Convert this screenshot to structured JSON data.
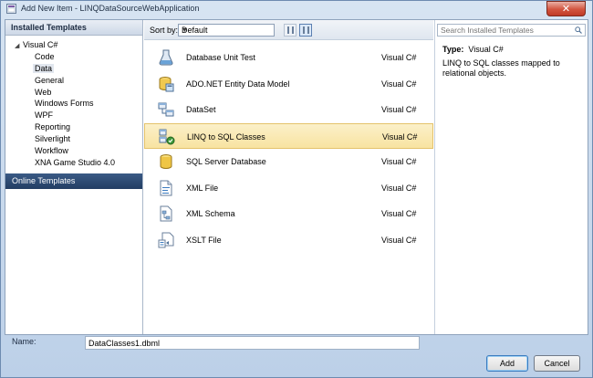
{
  "window": {
    "title": "Add New Item - LINQDataSourceWebApplication",
    "close_glyph": "✕"
  },
  "left": {
    "header": "Installed Templates",
    "root": "Visual C#",
    "children": [
      "Code",
      "Data",
      "General",
      "Web",
      "Windows Forms",
      "WPF",
      "Reporting",
      "Silverlight",
      "Workflow",
      "XNA Game Studio 4.0"
    ],
    "selected": "Data",
    "online": "Online Templates"
  },
  "toolbar": {
    "sort_label": "Sort by:",
    "sort_value": "Default"
  },
  "items": [
    {
      "name": "Database Unit Test",
      "lang": "Visual C#",
      "icon": "flask-test-icon"
    },
    {
      "name": "ADO.NET Entity Data Model",
      "lang": "Visual C#",
      "icon": "entity-model-icon"
    },
    {
      "name": "DataSet",
      "lang": "Visual C#",
      "icon": "dataset-icon"
    },
    {
      "name": "LINQ to SQL Classes",
      "lang": "Visual C#",
      "icon": "linq-classes-icon"
    },
    {
      "name": "SQL Server Database",
      "lang": "Visual C#",
      "icon": "database-cylinder-icon"
    },
    {
      "name": "XML File",
      "lang": "Visual C#",
      "icon": "xml-file-icon"
    },
    {
      "name": "XML Schema",
      "lang": "Visual C#",
      "icon": "xml-schema-icon"
    },
    {
      "name": "XSLT File",
      "lang": "Visual C#",
      "icon": "xslt-file-icon"
    }
  ],
  "selected_item": "LINQ to SQL Classes",
  "right": {
    "search_placeholder": "Search Installed Templates",
    "type_label": "Type:",
    "type_value": "Visual C#",
    "description": "LINQ to SQL classes mapped to relational objects."
  },
  "bottom": {
    "name_label": "Name:",
    "name_value": "DataClasses1.dbml",
    "add_label": "Add",
    "cancel_label": "Cancel"
  },
  "colors": {
    "selection_fill": "#f8e3a1",
    "online_bar": "#233e63",
    "close_button": "#d2543f"
  }
}
